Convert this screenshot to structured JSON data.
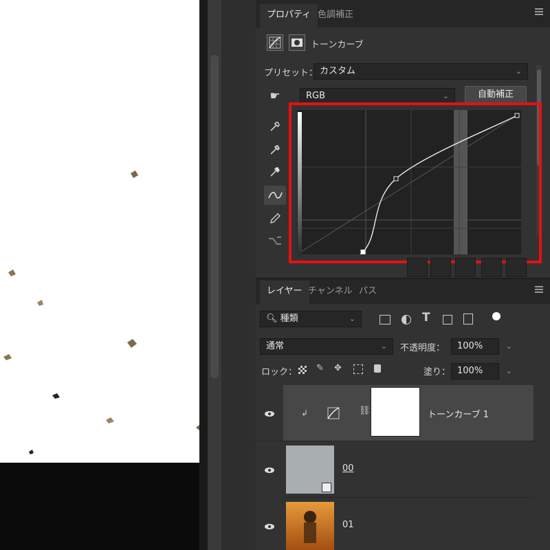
{
  "properties_panel": {
    "tabs": [
      "プロパティ",
      "色調補正"
    ],
    "adjustment_title": "トーンカーブ",
    "preset_label": "プリセット：",
    "preset_value": "カスタム",
    "channel_value": "RGB",
    "auto_button": "自動補正",
    "tool_icons": [
      "hand-target-icon",
      "eyedropper-black-icon",
      "eyedropper-gray-icon",
      "eyedropper-white-icon",
      "curve-point-icon",
      "pencil-icon",
      "smooth-curve-icon"
    ],
    "curve_points": [
      {
        "input": 0,
        "output": 0
      },
      {
        "input": 30,
        "output": 18
      },
      {
        "input": 45,
        "output": 62
      },
      {
        "input": 100,
        "output": 100
      }
    ],
    "highlight_color": "#e81010"
  },
  "layers_panel": {
    "tabs": [
      "レイヤー",
      "チャンネル",
      "パス"
    ],
    "filter_label": "種類",
    "blend_mode": "通常",
    "opacity_label": "不透明度：",
    "opacity_value": "100%",
    "lock_label": "ロック：",
    "fill_label": "塗り：",
    "fill_value": "100%",
    "layers": [
      {
        "name": "トーンカーブ 1",
        "type": "adjustment",
        "visible": true,
        "selected": true
      },
      {
        "name": "00",
        "type": "smart-object",
        "visible": true,
        "selected": false
      },
      {
        "name": "01",
        "type": "image",
        "visible": true,
        "selected": false
      }
    ]
  },
  "colors": {
    "panel_bg": "#323232",
    "dark_bg": "#262626",
    "canvas_bg": "#ffffff",
    "accent_red": "#e81010"
  }
}
